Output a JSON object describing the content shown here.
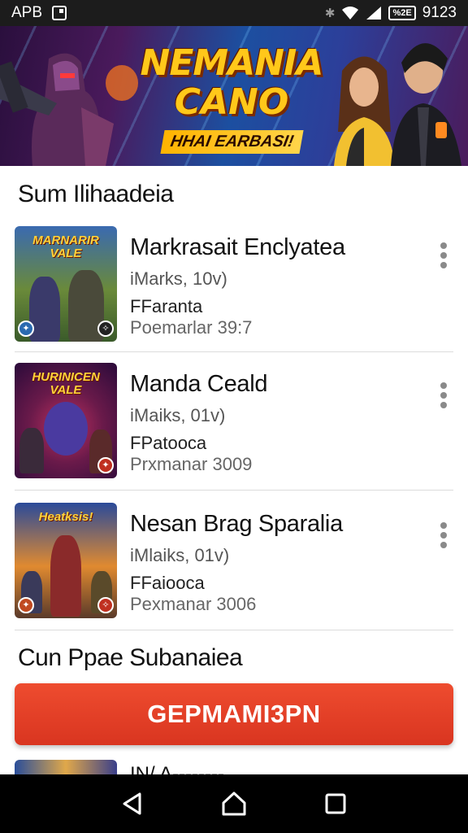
{
  "status_bar": {
    "carrier": "APB",
    "battery": "%2E",
    "time": "9123",
    "icons": [
      "notification-icon",
      "bluetooth-icon",
      "wifi-icon",
      "signal-icon",
      "battery-icon"
    ]
  },
  "banner": {
    "title_line1": "NEMANIA",
    "title_line2": "CANO",
    "tagline": "HHAI EARBASI!"
  },
  "sections": {
    "first_title": "Sum Ilihaadeia",
    "second_title": "Cun Ppae Subanaiea"
  },
  "items": [
    {
      "thumb_label": "MARNARIR VALE",
      "title": "Markrasait Enclyatea",
      "subtitle": "iMarks, 10v)",
      "genre": "FFaranta",
      "meta": "Poemarlar 39:7"
    },
    {
      "thumb_label": "HURINICEN VALE",
      "title": "Manda Ceald",
      "subtitle": "iMaiks, 01v)",
      "genre": "FPatooca",
      "meta": "Prxmanar 3009"
    },
    {
      "thumb_label": "Heatksis!",
      "title": "Nesan Brag Sparalia",
      "subtitle": "iMlaiks, 01v)",
      "genre": "FFaiooca",
      "meta": "Pexmanar 3006"
    }
  ],
  "cta": {
    "label": "GEPMAMI3PN"
  },
  "peek_item": {
    "title": "IN/ A--------"
  },
  "nav": {
    "back": "back-icon",
    "home": "home-icon",
    "recents": "recents-icon"
  },
  "colors": {
    "accent": "#e0402a",
    "status_bar": "#1c1c1c",
    "nav_bar": "#000000"
  }
}
